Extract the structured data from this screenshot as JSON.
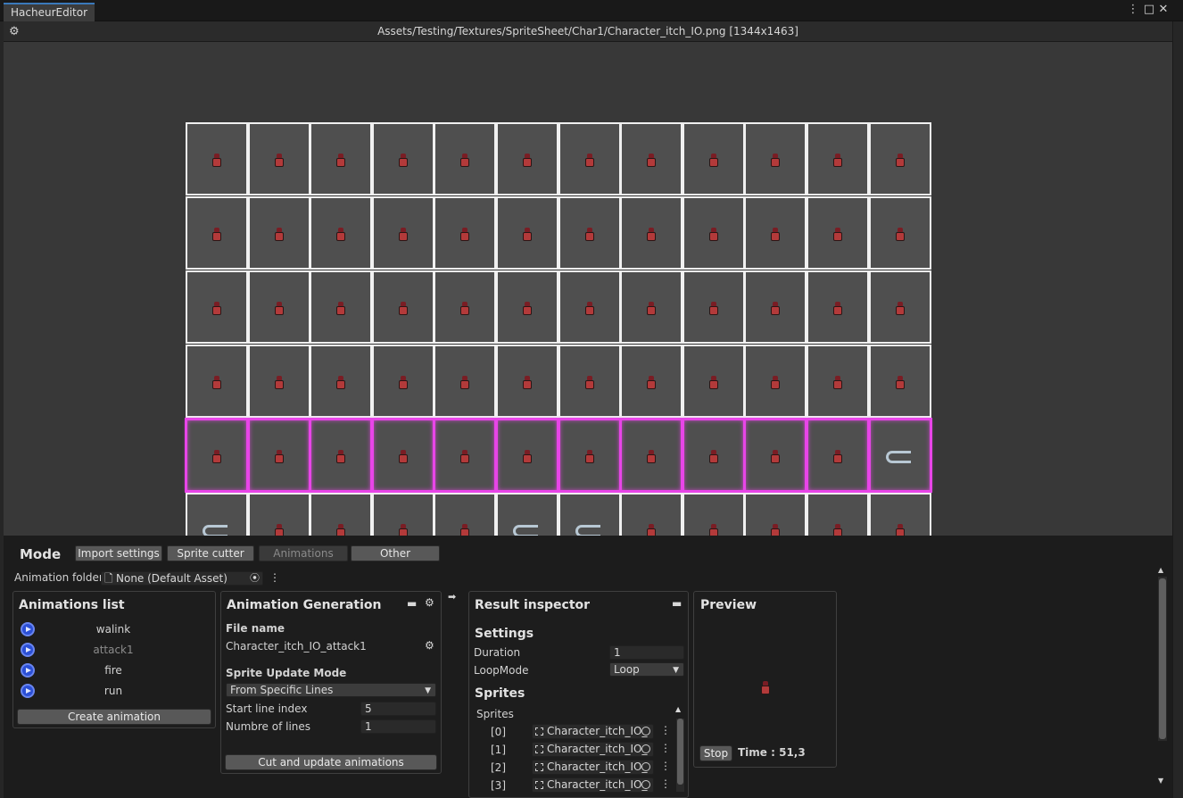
{
  "window": {
    "tab_title": "HacheurEditor"
  },
  "path_bar": {
    "path": "Assets/Testing/Textures/SpriteSheet/Char1/Character_itch_IO.png [1344x1463]"
  },
  "mode": {
    "label": "Mode",
    "tabs": [
      "Import settings",
      "Sprite cutter",
      "Animations",
      "Other"
    ],
    "active_tab": "Animations"
  },
  "animation_folder": {
    "label": "Animation folder",
    "value": "None (Default Asset)"
  },
  "animations_list": {
    "title": "Animations list",
    "items": [
      "walink",
      "attack1",
      "fire",
      "run"
    ],
    "selected": "attack1",
    "create_button": "Create animation"
  },
  "generation": {
    "title": "Animation Generation",
    "file_name_label": "File name",
    "file_name_value": "Character_itch_IO_attack1",
    "update_mode_label": "Sprite Update Mode",
    "update_mode_value": "From Specific Lines",
    "start_line_label": "Start line index",
    "start_line_value": "5",
    "num_lines_label": "Numbre of lines",
    "num_lines_value": "1",
    "cut_button": "Cut and update animations"
  },
  "result": {
    "title": "Result inspector",
    "settings_header": "Settings",
    "duration_label": "Duration",
    "duration_value": "1",
    "loopmode_label": "LoopMode",
    "loopmode_value": "Loop",
    "sprites_header": "Sprites",
    "sprites_list_label": "Sprites",
    "sprites": [
      {
        "index": "[0]",
        "name": "Character_itch_IO_"
      },
      {
        "index": "[1]",
        "name": "Character_itch_IO_"
      },
      {
        "index": "[2]",
        "name": "Character_itch_IO_"
      },
      {
        "index": "[3]",
        "name": "Character_itch_IO_"
      }
    ]
  },
  "preview": {
    "title": "Preview",
    "stop_button": "Stop",
    "time_text": "Time : 51,3"
  },
  "colors": {
    "selection": "#e845e8",
    "accent": "#3a79bb",
    "cell_bg": "#4f4f4f",
    "grid_line": "#f0f0f0"
  },
  "sheet": {
    "columns": 12,
    "visible_rows": 6,
    "selected_row": 4
  }
}
